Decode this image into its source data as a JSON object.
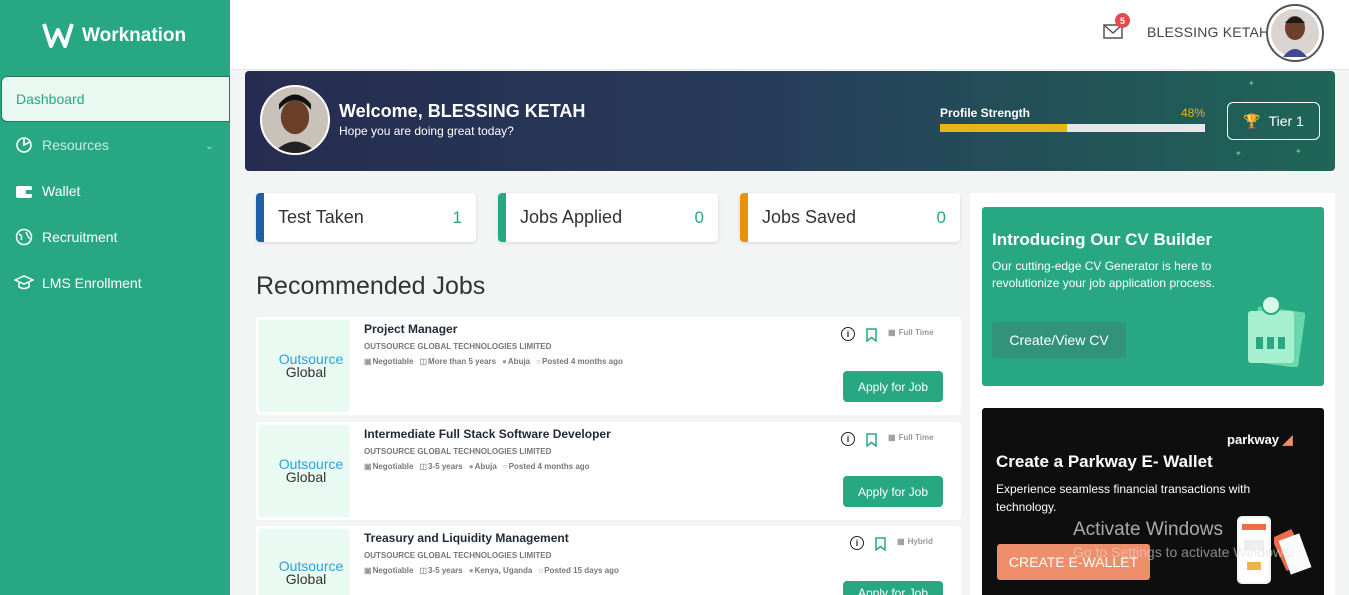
{
  "brand": {
    "name": "Worknation"
  },
  "sidebar": {
    "items": [
      {
        "label": "Dashboard",
        "icon": "dashboard"
      },
      {
        "label": "Resources",
        "icon": "resources-icon"
      },
      {
        "label": "Wallet",
        "icon": "wallet-icon"
      },
      {
        "label": "Recruitment",
        "icon": "globe-icon"
      },
      {
        "label": "LMS Enrollment",
        "icon": "graduation-cap-icon"
      }
    ]
  },
  "header": {
    "notification_count": "5",
    "user_name": "BLESSING KETAH"
  },
  "banner": {
    "welcome": "Welcome, BLESSING KETAH",
    "subtitle": "Hope you are doing great today?",
    "profile_strength_label": "Profile Strength",
    "profile_strength_value": "48%",
    "profile_strength_fraction": 0.48,
    "tier_label": "Tier 1"
  },
  "stats": [
    {
      "label": "Test Taken",
      "value": "1",
      "color": "#1f5fa8"
    },
    {
      "label": "Jobs Applied",
      "value": "0",
      "color": "#27a882"
    },
    {
      "label": "Jobs Saved",
      "value": "0",
      "color": "#e8920c"
    }
  ],
  "recommended": {
    "title": "Recommended Jobs",
    "logo_line1": "Outsource",
    "logo_line2": "Global",
    "jobs": [
      {
        "title": "Project Manager",
        "company": "OUTSOURCE GLOBAL TECHNOLOGIES LIMITED",
        "salary": "Negotiable",
        "experience": "More than 5 years",
        "location": "Abuja",
        "posted": "Posted 4 months ago",
        "type": "Full Time",
        "apply": "Apply for Job"
      },
      {
        "title": "Intermediate Full Stack Software Developer",
        "company": "OUTSOURCE GLOBAL TECHNOLOGIES LIMITED",
        "salary": "Negotiable",
        "experience": "3-5 years",
        "location": "Abuja",
        "posted": "Posted 4 months ago",
        "type": "Full Time",
        "apply": "Apply for Job"
      },
      {
        "title": "Treasury and Liquidity Management",
        "company": "OUTSOURCE GLOBAL TECHNOLOGIES LIMITED",
        "salary": "Negotiable",
        "experience": "3-5 years",
        "location": "Kenya, Uganda",
        "posted": "Posted 15 days ago",
        "type": "Hybrid",
        "apply": "Apply for Job"
      }
    ]
  },
  "cv_builder": {
    "title": "Introducing Our CV Builder",
    "text": "Our cutting-edge CV Generator is here to revolutionize your job application process.",
    "button": "Create/View CV"
  },
  "parkway": {
    "logo": "parkway",
    "title": "Create a Parkway E- Wallet",
    "text": "Experience seamless financial transactions with technology.",
    "button": "CREATE E-WALLET"
  },
  "watermark": {
    "title": "Activate Windows",
    "subtitle": "Go to Settings to activate Windows."
  }
}
